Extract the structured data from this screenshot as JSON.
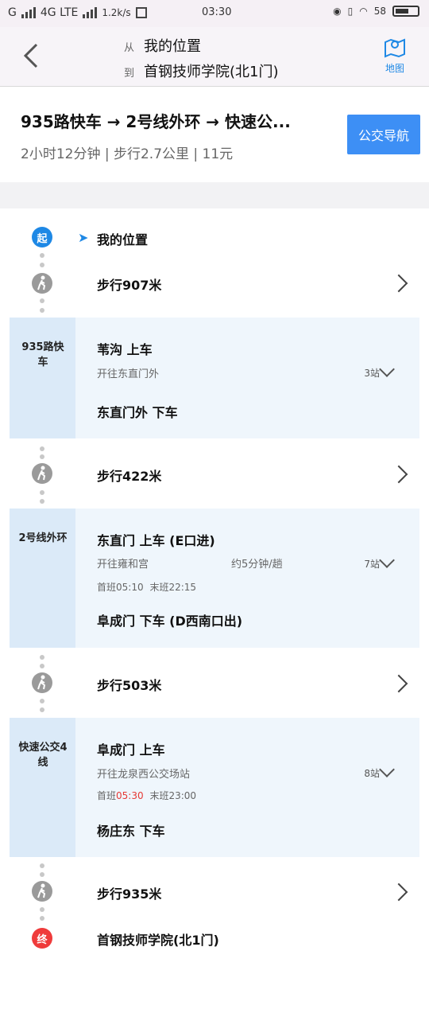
{
  "status_bar": {
    "carrier": "G",
    "network": "4G LTE",
    "speed": "1.2k/s",
    "time": "03:30",
    "battery": "58"
  },
  "header": {
    "from_label": "从",
    "from": "我的位置",
    "to_label": "到",
    "to": "首钢技师学院(北1门)",
    "map_label": "地图"
  },
  "summary": {
    "title": "935路快车 → 2号线外环 → 快速公...",
    "meta": "2小时12分钟 | 步行2.7公里 | 11元",
    "nav_button": "公交导航"
  },
  "steps": {
    "start_badge": "起",
    "start_place": "我的位置",
    "walk1": "步行907米",
    "walk2": "步行422米",
    "walk3": "步行503米",
    "walk4": "步行935米",
    "end_badge": "终",
    "end_place": "首钢技师学院(北1门)"
  },
  "transit": [
    {
      "line": "935路快车",
      "board": "苇沟 上车",
      "direction": "开往东直门外",
      "stops": "3站",
      "alight": "东直门外 下车"
    },
    {
      "line": "2号线外环",
      "board": "东直门 上车 (E口进)",
      "direction": "开往雍和宫",
      "frequency": "约5分钟/趟",
      "stops": "7站",
      "first_label": "首班",
      "first_time": "05:10",
      "last_label": "末班",
      "last_time": "22:15",
      "alight": "阜成门 下车 (D西南口出)"
    },
    {
      "line": "快速公交4线",
      "board": "阜成门 上车",
      "direction": "开往龙泉西公交场站",
      "stops": "8站",
      "first_label": "首班",
      "first_time": "05:30",
      "last_label": "末班",
      "last_time": "23:00",
      "alight": "杨庄东 下车"
    }
  ],
  "colors": {
    "accent": "#3d8ff5",
    "start": "#1e88e5",
    "end": "#ef3b3b",
    "transit_bg": "#eff6fc",
    "highlight_time": "#e53935"
  }
}
